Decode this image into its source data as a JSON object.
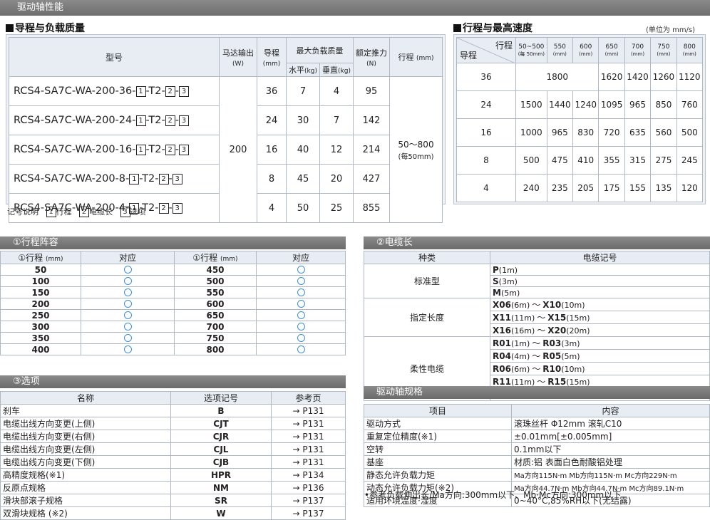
{
  "banner": "驱动轴性能",
  "lead": {
    "title": "导程与负载质量",
    "headers": {
      "model": "型号",
      "motor": "马达输出",
      "motor_unit": "(W)",
      "lead": "导程",
      "lead_unit": "(mm)",
      "maxload": "最大负载质量",
      "horiz": "水平",
      "horiz_unit": "(kg)",
      "vert": "垂直",
      "vert_unit": "(kg)",
      "thrust": "额定推力",
      "thrust_unit": "(N)",
      "stroke": "行程",
      "stroke_unit": "(mm)"
    },
    "motor_value": "200",
    "stroke_value": "50～800",
    "stroke_pitch": "(每50mm)",
    "rows": [
      {
        "model": "RCS4-SA7C-WA-200-36-",
        "lead": "36",
        "horiz": "7",
        "vert": "4",
        "thrust": "95"
      },
      {
        "model": "RCS4-SA7C-WA-200-24-",
        "lead": "24",
        "horiz": "30",
        "vert": "7",
        "thrust": "142"
      },
      {
        "model": "RCS4-SA7C-WA-200-16-",
        "lead": "16",
        "horiz": "40",
        "vert": "12",
        "thrust": "214"
      },
      {
        "model": "RCS4-SA7C-WA-200-8-",
        "lead": "8",
        "horiz": "45",
        "vert": "20",
        "thrust": "427"
      },
      {
        "model": "RCS4-SA7C-WA-200-4-",
        "lead": "4",
        "horiz": "50",
        "vert": "25",
        "thrust": "855"
      }
    ],
    "box1": "1",
    "box2": "2",
    "box3": "3",
    "t2": "-T2-",
    "dash": "-",
    "legend": {
      "title": "记号说明",
      "item1": "行程",
      "item2": "电缆长",
      "item3": "选项"
    }
  },
  "speed": {
    "title": "行程与最高速度",
    "unit": "(单位为 mm/s)",
    "corner_top": "行程",
    "corner_bottom": "导程",
    "cols": [
      {
        "label": "50~500",
        "sub": "(每 50mm)"
      },
      {
        "label": "550",
        "sub": "(mm)"
      },
      {
        "label": "600",
        "sub": "(mm)"
      },
      {
        "label": "650",
        "sub": "(mm)"
      },
      {
        "label": "700",
        "sub": "(mm)"
      },
      {
        "label": "750",
        "sub": "(mm)"
      },
      {
        "label": "800",
        "sub": "(mm)"
      }
    ],
    "rows": [
      {
        "lead": "36",
        "merged": "1800",
        "v": [
          "1620",
          "1420",
          "1260",
          "1120"
        ]
      },
      {
        "lead": "24",
        "v": [
          "1500",
          "1440",
          "1240",
          "1095",
          "965",
          "850",
          "760"
        ]
      },
      {
        "lead": "16",
        "v": [
          "1000",
          "965",
          "830",
          "720",
          "635",
          "560",
          "500"
        ]
      },
      {
        "lead": "8",
        "v": [
          "500",
          "475",
          "410",
          "355",
          "315",
          "275",
          "245"
        ]
      },
      {
        "lead": "4",
        "v": [
          "240",
          "235",
          "205",
          "175",
          "155",
          "135",
          "120"
        ]
      }
    ]
  },
  "stroke_list": {
    "title": "①行程阵容",
    "h_stroke": "①行程",
    "h_unit": "(mm)",
    "h_avail": "对应",
    "left": [
      "50",
      "100",
      "150",
      "200",
      "250",
      "300",
      "350",
      "400"
    ],
    "right": [
      "450",
      "500",
      "550",
      "600",
      "650",
      "700",
      "750",
      "800"
    ]
  },
  "cable": {
    "title": "②电缆长",
    "h_type": "种类",
    "h_code": "电缆记号",
    "groups": [
      {
        "type": "标准型",
        "items": [
          {
            "a": "P",
            "al": "(1m)"
          },
          {
            "a": "S",
            "al": "(3m)"
          },
          {
            "a": "M",
            "al": "(5m)"
          }
        ]
      },
      {
        "type": "指定长度",
        "items": [
          {
            "a": "X06",
            "al": "(6m)",
            "b": "X10",
            "bl": "(10m)"
          },
          {
            "a": "X11",
            "al": "(11m)",
            "b": "X15",
            "bl": "(15m)"
          },
          {
            "a": "X16",
            "al": "(16m)",
            "b": "X20",
            "bl": "(20m)"
          }
        ]
      },
      {
        "type": "柔性电缆",
        "items": [
          {
            "a": "R01",
            "al": "(1m)",
            "b": "R03",
            "bl": "(3m)"
          },
          {
            "a": "R04",
            "al": "(4m)",
            "b": "R05",
            "bl": "(5m)"
          },
          {
            "a": "R06",
            "al": "(6m)",
            "b": "R10",
            "bl": "(10m)"
          },
          {
            "a": "R11",
            "al": "(11m)",
            "b": "R15",
            "bl": "(15m)"
          },
          {
            "a": "R16",
            "al": "(16m)",
            "b": "R20",
            "bl": "(20m)"
          }
        ]
      }
    ],
    "tilde": "～"
  },
  "options": {
    "title": "③选项",
    "h_name": "名称",
    "h_code": "选项记号",
    "h_page": "参考页",
    "rows": [
      {
        "name": "刹车",
        "code": "B",
        "page": "→ P131"
      },
      {
        "name": "电缆出线方向变更(上侧)",
        "code": "CJT",
        "page": "→ P131"
      },
      {
        "name": "电缆出线方向变更(右侧)",
        "code": "CJR",
        "page": "→ P131"
      },
      {
        "name": "电缆出线方向变更(左侧)",
        "code": "CJL",
        "page": "→ P131"
      },
      {
        "name": "电缆出线方向变更(下侧)",
        "code": "CJB",
        "page": "→ P131"
      },
      {
        "name": "高精度规格(※1)",
        "code": "HPR",
        "page": "→ P134"
      },
      {
        "name": "反原点规格",
        "code": "NM",
        "page": "→ P136"
      },
      {
        "name": "滑块部滚子规格",
        "code": "SR",
        "page": "→ P137"
      },
      {
        "name": "双滑块规格 (※2)",
        "code": "W",
        "page": "→ P137"
      }
    ]
  },
  "spec": {
    "title": "驱动轴规格",
    "h_item": "项目",
    "h_content": "内容",
    "rows": [
      {
        "item": "驱动方式",
        "content": "滚珠丝杆 Φ12mm 滚轧C10"
      },
      {
        "item": "重复定位精度(※1)",
        "content": "±0.01mm[±0.005mm]"
      },
      {
        "item": "空转",
        "content": "0.1mm以下"
      },
      {
        "item": "基座",
        "content": "材质:铝 表面白色耐酸铝处理"
      },
      {
        "item": "静态允许负载力矩",
        "content": "Ma方向115N·m Mb方向115N·m Mc方向229N·m"
      },
      {
        "item": "动态允许负载力矩(※2)",
        "content": "Ma方向44.7N·m Mb方向44.7N·m Mc方向89.1N·m"
      },
      {
        "item": "适用环境温度·湿度",
        "content": "0~40°C,85%RH以下(无结露)"
      }
    ],
    "footnote": "•参考负载伸出长/Ma方向:300mm以下、Mb·Mc方向:300mm以下"
  }
}
